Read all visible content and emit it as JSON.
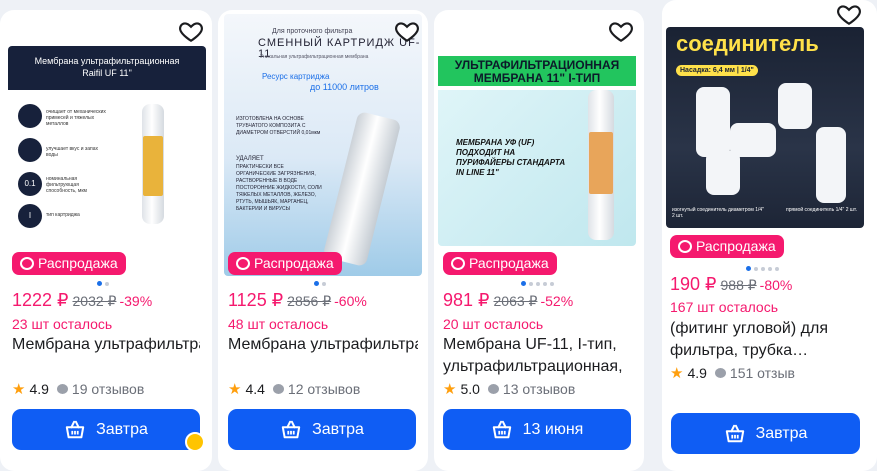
{
  "products": [
    {
      "image_title_line1": "Мембрана ультрафильтрационная",
      "image_title_line2": "Raifil UF 11\"",
      "image_features": [
        "очищает от механических примесей и тяжелых металлов",
        "улучшает вкус и запах воды",
        "номинальная фильтрующая способность, мкм",
        "тип картриджа"
      ],
      "image_feature_values": [
        "",
        "",
        "0.1",
        "I"
      ],
      "badge": "Распродажа",
      "price": "1222 ₽",
      "old_price": "2032 ₽",
      "discount": "-39%",
      "stock": "23 шт осталось",
      "title": "Мембрана ультрафильтрационная…",
      "rating": "4.9",
      "reviews": "19 отзывов",
      "button": "Завтра"
    },
    {
      "image_top": "Для проточного фильтра",
      "image_headline": "СМЕННЫЙ КАРТРИДЖ UF-11",
      "image_sub": "Уникальная ультрафильтрационная мембрана",
      "image_resource": "Ресурс картриджа",
      "image_resource2": "до 11000 литров",
      "image_text1": "ИЗГОТОВЛЕНА НА ОСНОВЕ ТРУБЧАТОГО КОМПОЗИТА С ДИАМЕТРОМ ОТВЕРСТИЙ 0,01мкм",
      "image_text2": "УДАЛЯЕТ",
      "image_text3": "ПРАКТИЧЕСКИ ВСЕ ОРГАНИЧЕСКИЕ ЗАГРЯЗНЕНИЯ, РАСТВОРЕННЫЕ В ВОДЕ ПОСТОРОННИЕ ЖИДКОСТИ, СОЛИ ТЯЖЕЛЫХ МЕТАЛЛОВ, ЖЕЛЕЗО, РТУТЬ, МЫШЬЯК, МАРГАНЕЦ, БАКТЕРИИ И ВИРУСЫ",
      "badge": "Распродажа",
      "price": "1125 ₽",
      "old_price": "2856 ₽",
      "discount": "-60%",
      "stock": "48 шт осталось",
      "title": "Мембрана ультрафильтрационная…",
      "rating": "4.4",
      "reviews": "12 отзывов",
      "button": "Завтра"
    },
    {
      "image_headline1": "УЛЬТРАФИЛЬТРАЦИОННАЯ",
      "image_headline2": "МЕМБРАНА 11\" I-ТИП",
      "image_text": "МЕМБРАНА УФ (UF) ПОДХОДИТ НА ПУРИФАЙЕРЫ СТАНДАРТА IN LINE 11\"",
      "badge": "Распродажа",
      "price": "981 ₽",
      "old_price": "2063 ₽",
      "discount": "-52%",
      "stock": "20 шт осталось",
      "title": "Мембрана UF-11, I-тип, ультрафильтрационная,",
      "rating": "5.0",
      "reviews": "13 отзывов",
      "button": "13 июня"
    },
    {
      "image_headline": "соединитель",
      "image_sub": "Насадка: 6,4 мм | 1/4\"",
      "image_caption1": "изогнутый соединитель диаметром 1/4\" 2 шт.",
      "image_caption2": "прямой соединитель 1/4\" 2 шт.",
      "badge": "Распродажа",
      "price": "190 ₽",
      "old_price": "988 ₽",
      "discount": "-80%",
      "stock": "167 шт осталось",
      "title_line1": "(фитинг угловой) для",
      "title_line2": "фильтра, трубка…",
      "rating": "4.9",
      "reviews": "151 отзыв",
      "button": "Завтра"
    }
  ],
  "colors": {
    "accent": "#0f5df4",
    "sale": "#f5196e",
    "star": "#ff9f0e"
  },
  "icons": [
    "heart-icon",
    "cart-icon",
    "star-icon",
    "comment-icon",
    "sale-icon"
  ]
}
